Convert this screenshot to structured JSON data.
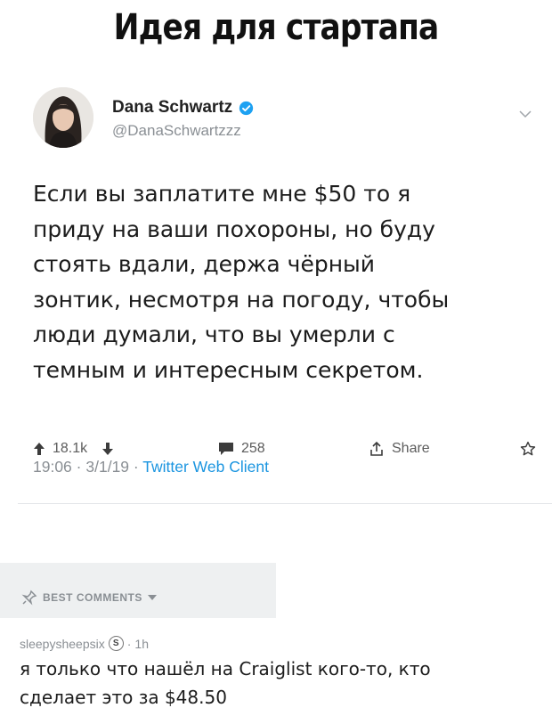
{
  "meme": {
    "title": "Идея для стартапа"
  },
  "tweet": {
    "author_name": "Dana Schwartz",
    "handle": "@DanaSchwartzzz",
    "text_lines": [
      "Если вы заплатите мне $50 то я",
      "приду на ваши похороны, но буду",
      "стоять вдали, держа чёрный",
      "зонтик, несмотря на погоду, чтобы",
      "люди думали, что вы умерли с",
      "темным и интересным секретом."
    ],
    "time": "19:06",
    "date": "3/1/19",
    "separator": "·",
    "client": "Twitter Web Client"
  },
  "actions": {
    "upvotes": "18.1k",
    "comments": "258",
    "share": "Share"
  },
  "comments": {
    "section_label": "BEST COMMENTS",
    "items": [
      {
        "username": "sleepysheepsix",
        "badge": "S",
        "age": "1h",
        "separator": "·",
        "text_lines": [
          "я только что нашёл на Craiglist кого-то, кто",
          "сделает это за $48.50"
        ]
      }
    ]
  },
  "colors": {
    "link": "#1b95e0",
    "verified": "#1da1f2",
    "muted": "#8a8f94"
  },
  "icons": [
    "verified-badge-icon",
    "chevron-down-icon",
    "upvote-arrow-icon",
    "downvote-arrow-icon",
    "comment-icon",
    "share-icon",
    "star-icon",
    "thumbtack-icon",
    "caret-down-icon"
  ]
}
